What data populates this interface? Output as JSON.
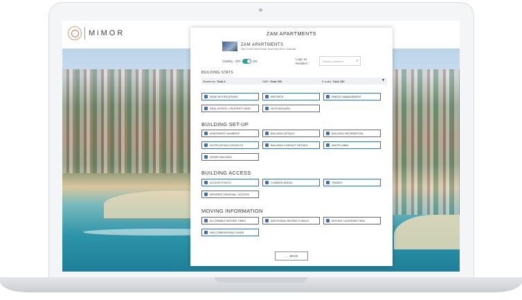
{
  "brand": {
    "logo_text": "MiMOR"
  },
  "panel": {
    "title": "ZAM APARTMENTS",
    "building_name": "ZAM APARTMENTS",
    "building_address": "New South Head Road, Rose Bay NSW, Australia",
    "visibility_label": "Visibility",
    "toggle_off": "OFF",
    "toggle_on": "ON",
    "login_as_label": "Login as Resident",
    "resident_select_placeholder": "Select a resident"
  },
  "stats": {
    "heading": "BUILDING STATS",
    "residents_label": "Residents:",
    "residents_value": "Total 6",
    "sms_label": "SMS:",
    "sms_value": "Total 255",
    "emails_label": "E-mails:",
    "emails_value": "Total 130"
  },
  "sections": {
    "top": [
      "SEND NOTIFICATIONS",
      "REPORTS",
      "PARCEL MANAGEMENT",
      "REAL ESTATE / PROPERTY MGR",
      "NOTICEBOARD"
    ],
    "setup_title": "BUILDING SET-UP",
    "setup": [
      "APARTMENT NUMBERS",
      "BUILDING DETAILS",
      "BUILDING INFORMATION",
      "NOTIFICATION CONTACTS",
      "BUILDING CONTACT DETAILS",
      "WHITE LABEL",
      "SHARE BUILDING"
    ],
    "access_title": "BUILDING ACCESS",
    "access": [
      "ACCESS POINTS",
      "COMMON AREAS",
      "TRADES",
      "RESIDENT REMOVAL / ACCESS"
    ],
    "moving_title": "MOVING INFORMATION",
    "moving": [
      "ALLOWABLE MOVING TIMES",
      "ADDITIONAL MOVING E-MAILS",
      "MOVING CALENDAR VIEW",
      "WELCOME/MOVING GUIDE"
    ]
  },
  "back_label": "BACK",
  "colors": {
    "accent": "#3f6fb5",
    "toggle": "#26a69a"
  }
}
